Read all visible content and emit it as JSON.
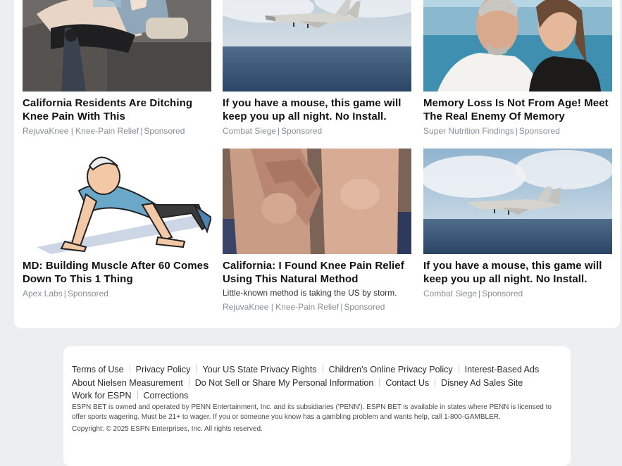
{
  "ads": [
    {
      "title": "California Residents Are Ditching Knee Pain With This",
      "desc": "",
      "source": "RejuvaKnee | Knee-Pain Relief",
      "sponsored": "Sponsored",
      "image": "knee-brace-photo"
    },
    {
      "title": "If you have a mouse, this game will keep you up all night. No Install.",
      "desc": "",
      "source": "Combat Siege",
      "sponsored": "Sponsored",
      "image": "fighter-jet-photo"
    },
    {
      "title": "Memory Loss Is Not From Age! Meet The Real Enemy Of Memory",
      "desc": "",
      "source": "Super Nutrition Findings",
      "sponsored": "Sponsored",
      "image": "couple-portrait-photo"
    },
    {
      "title": "MD: Building Muscle After 60 Comes Down To This 1 Thing",
      "desc": "",
      "source": "Apex Labs",
      "sponsored": "Sponsored",
      "image": "pushup-illustration"
    },
    {
      "title": "California: I Found Knee Pain Relief Using This Natural Method",
      "desc": "Little-known method is taking the US by storm.",
      "source": "RejuvaKnee | Knee-Pain Relief",
      "sponsored": "Sponsored",
      "image": "knee-closeup-photo"
    },
    {
      "title": "If you have a mouse, this game will keep you up all night. No Install.",
      "desc": "",
      "source": "Combat Siege",
      "sponsored": "Sponsored",
      "image": "fighter-jet-photo"
    }
  ],
  "footer": {
    "links_row1": [
      "Terms of Use",
      "Privacy Policy",
      "Your US State Privacy Rights",
      "Children's Online Privacy Policy",
      "Interest-Based Ads"
    ],
    "links_row2": [
      "About Nielsen Measurement",
      "Do Not Sell or Share My Personal Information",
      "Contact Us",
      "Disney Ad Sales Site"
    ],
    "links_row3": [
      "Work for ESPN",
      "Corrections"
    ],
    "legal": "ESPN BET is owned and operated by PENN Entertainment, Inc. and its subsidiaries ('PENN'). ESPN BET is available in states where PENN is licensed to offer sports wagering. Must be 21+ to wager. If you or someone you know has a gambling problem and wants help, call 1-800-GAMBLER.",
    "copyright": "Copyright: © 2025 ESPN Enterprises, Inc. All rights reserved."
  }
}
